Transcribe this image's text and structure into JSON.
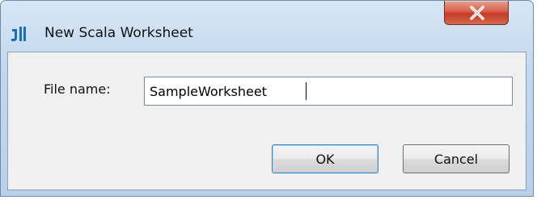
{
  "window": {
    "title": "New Scala Worksheet",
    "icon": "intellij-app-icon"
  },
  "titlebar": {
    "close_icon": "close-icon",
    "close_color": "#c43a25"
  },
  "form": {
    "file_name_label": "File name:",
    "file_name_value": "SampleWorksheet"
  },
  "buttons": {
    "ok_label": "OK",
    "cancel_label": "Cancel"
  }
}
